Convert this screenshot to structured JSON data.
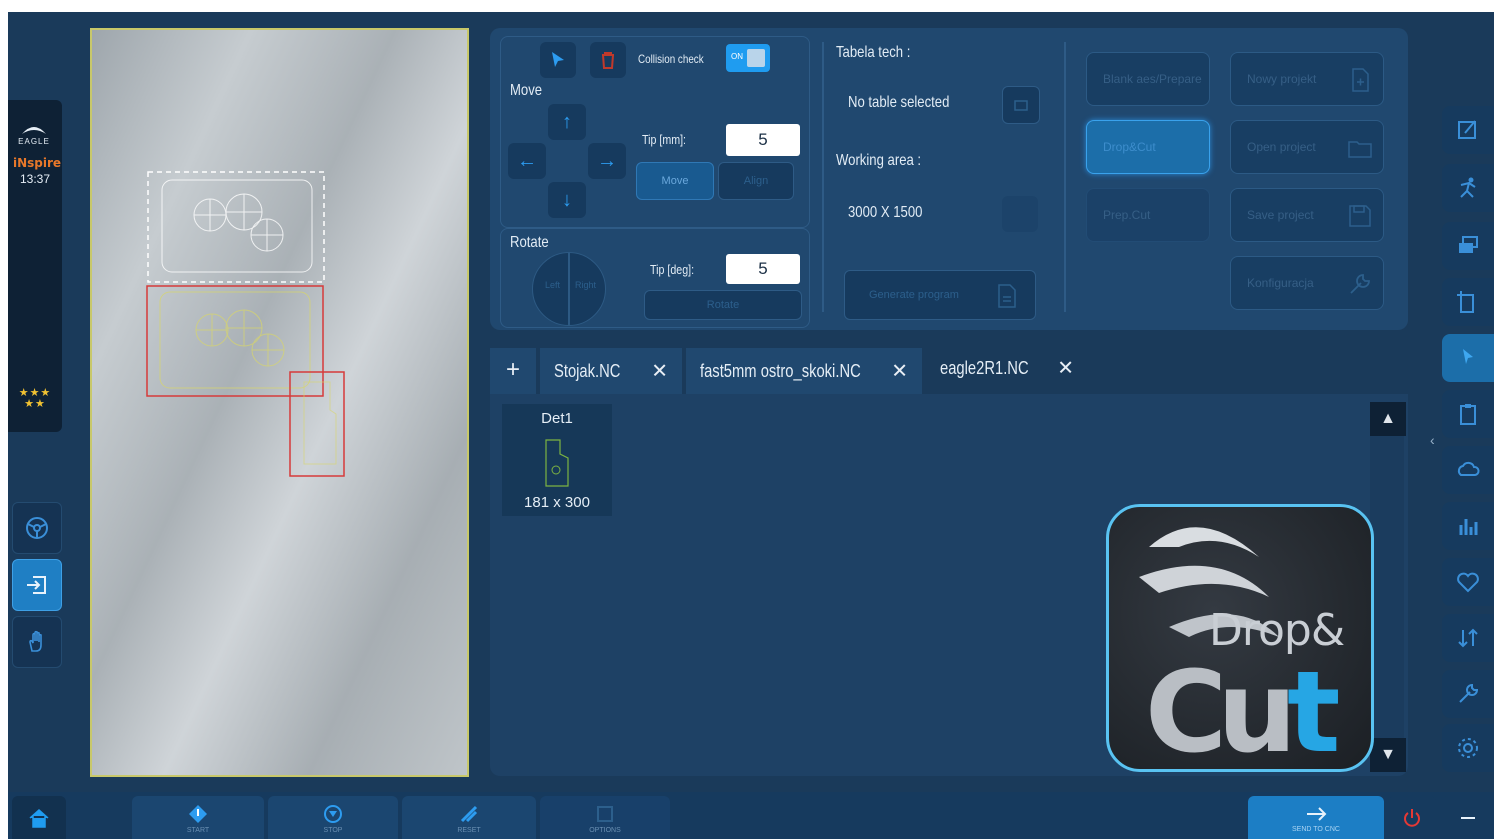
{
  "app": {
    "logo_text": "EAGLE",
    "logo_word": "iNspire",
    "time": "13:37",
    "stars": "★★★\n★★"
  },
  "controls": {
    "collision_label": "Collision check",
    "toggle_label": "ON",
    "move_label": "Move",
    "tip_mm_label": "Tip [mm]:",
    "tip_mm_value": "5",
    "move_btn1": "Move",
    "move_btn2": "Align",
    "rotate_label": "Rotate",
    "tip_deg_label": "Tip [deg]:",
    "tip_deg_value": "5",
    "rotate_left": "Left",
    "rotate_right": "Right",
    "rotate_btn": "Rotate"
  },
  "tech": {
    "table_label": "Tabela tech :",
    "table_value": "No table selected",
    "area_label": "Working area :",
    "area_value": "3000 X 1500",
    "generate_label": "Generate program"
  },
  "actions": {
    "col1": [
      "Blank aes/Prepare",
      "Drop&Cut",
      "Prep.Cut"
    ],
    "col2": [
      "Nowy projekt",
      "Open project",
      "Save project",
      "Konfiguracja"
    ]
  },
  "tabs": [
    {
      "label": "Stojak.NC"
    },
    {
      "label": "fast5mm ostro_skoki.NC"
    },
    {
      "label": "eagle2R1.NC"
    }
  ],
  "parts": [
    {
      "name": "Det1",
      "size": "181 x 300"
    }
  ],
  "brand": {
    "drop": "Drop&",
    "cut_c": "C",
    "cut_u": "u",
    "cut_t": "t"
  },
  "bottom": {
    "labels": [
      "START",
      "STOP",
      "RESET",
      "OPTIONS",
      "SEND TO CNC"
    ]
  },
  "colors": {
    "background": "#1a3a5a",
    "panel": "#20486f",
    "accent": "#1f9cf0",
    "sheet_border": "#c8c86a",
    "part_outline": "#d63a3a"
  }
}
